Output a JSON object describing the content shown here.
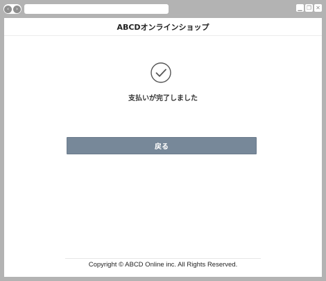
{
  "browser": {
    "back_icon": "‹",
    "forward_icon": "›",
    "minimize_icon": "▁",
    "restore_icon": "❐",
    "close_icon": "✕"
  },
  "header": {
    "title": "ABCDオンラインショップ"
  },
  "main": {
    "message": "支払いが完了しました",
    "back_label": "戻る",
    "button_color": "#778899"
  },
  "footer": {
    "copyright": "Copyright © ABCD Online inc. All Rights Reserved."
  }
}
